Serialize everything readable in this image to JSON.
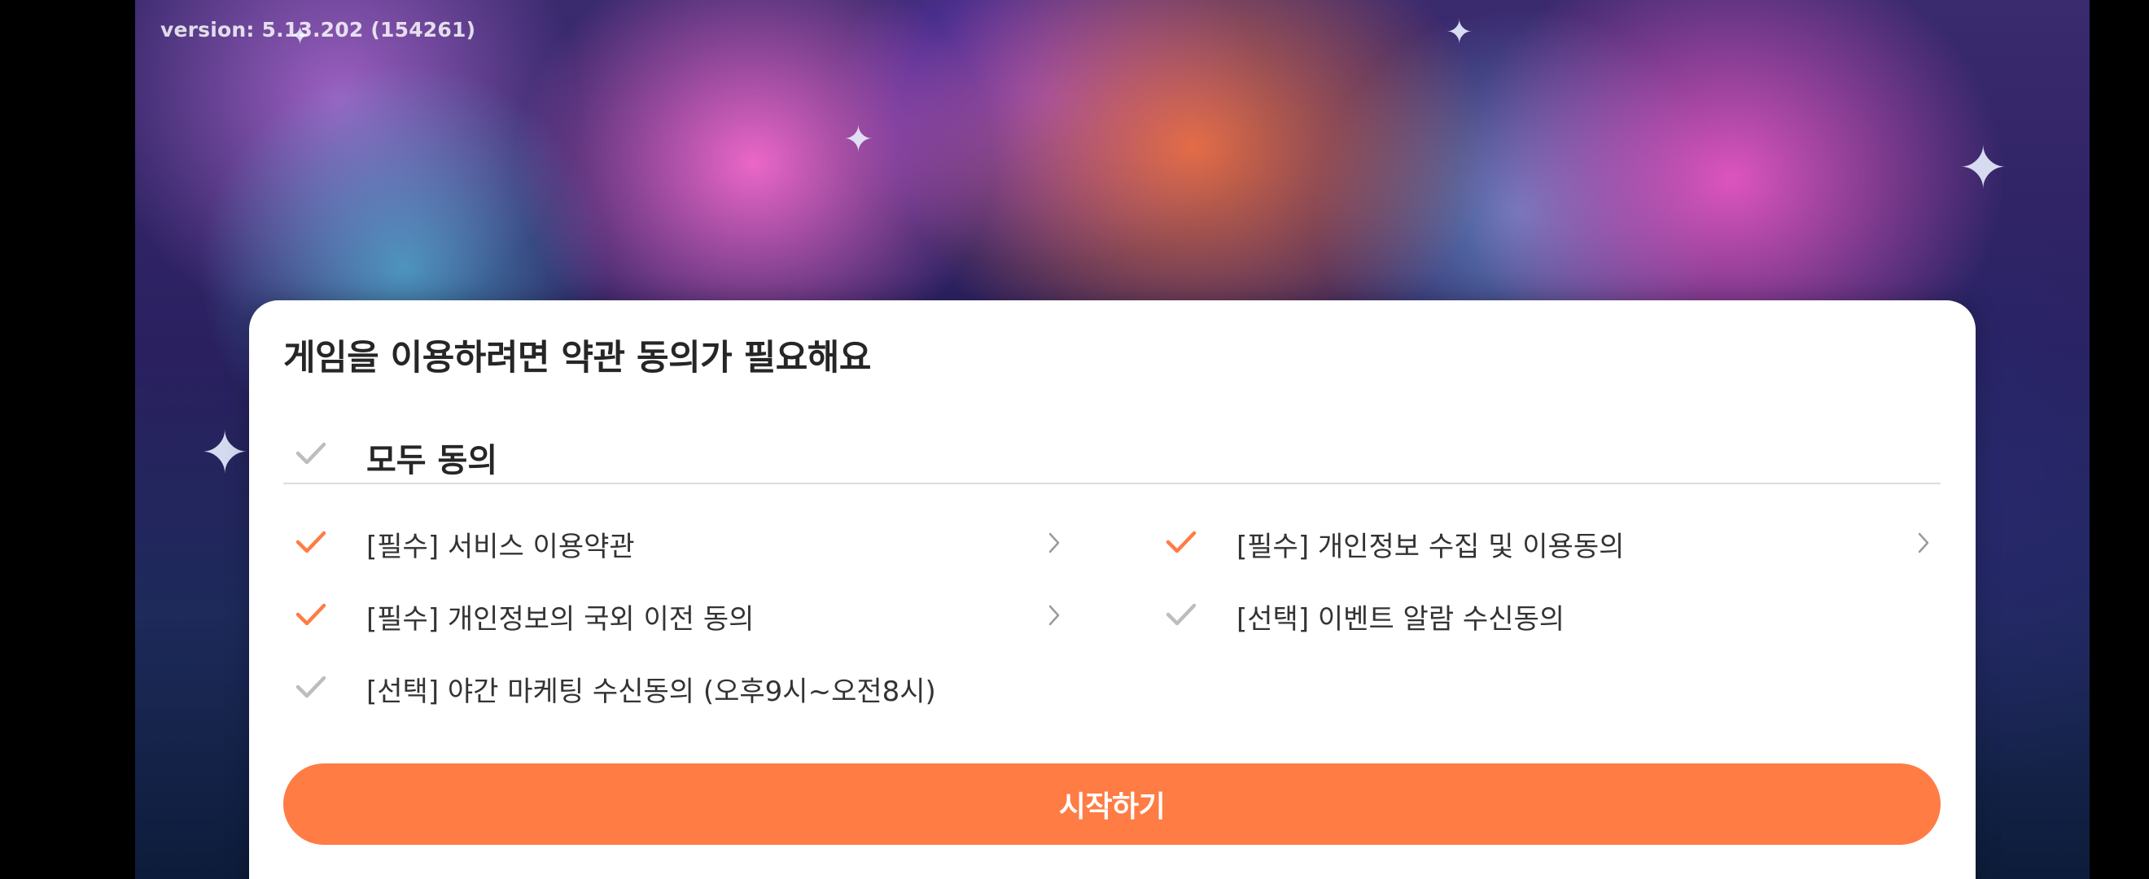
{
  "version_text": "version: 5.13.202 (154261)",
  "dialog": {
    "title": "게임을 이용하려면 약관 동의가 필요해요",
    "agree_all": {
      "label": "모두 동의",
      "checked": false
    },
    "items": [
      {
        "label": "[필수] 서비스 이용약관",
        "checked": true,
        "has_detail": true
      },
      {
        "label": "[필수] 개인정보 수집 및 이용동의",
        "checked": true,
        "has_detail": true
      },
      {
        "label": "[필수] 개인정보의 국외 이전 동의",
        "checked": true,
        "has_detail": true
      },
      {
        "label": "[선택] 이벤트 알람 수신동의",
        "checked": false,
        "has_detail": false
      },
      {
        "label": "[선택] 야간 마케팅 수신동의 (오후9시~오전8시)",
        "checked": false,
        "has_detail": false
      }
    ],
    "start_button": "시작하기"
  },
  "colors": {
    "accent": "#ff7c44",
    "check_on": "#ff7c44",
    "check_off": "#bdbdbd",
    "text": "#333333"
  },
  "icons": {
    "check": "check-icon",
    "chevron": "chevron-right-icon"
  }
}
